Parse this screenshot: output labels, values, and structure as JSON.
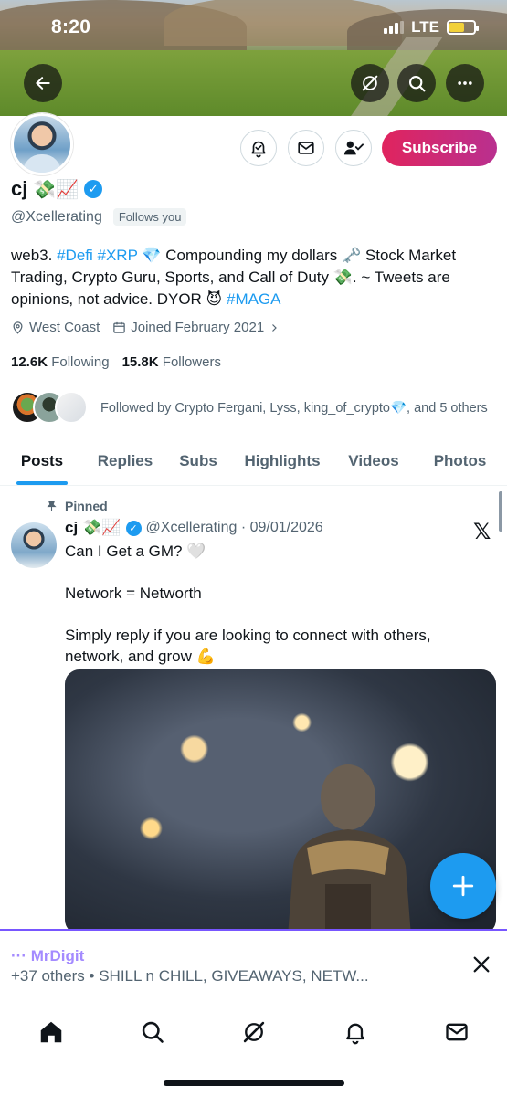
{
  "status_bar": {
    "time": "8:20",
    "network": "LTE"
  },
  "profile": {
    "name": "cj",
    "name_emojis": "💸📈",
    "handle": "@Xcellerating",
    "follows_you": "Follows you",
    "subscribe_label": "Subscribe",
    "bio_parts": [
      {
        "text": "web3. ",
        "tag": false
      },
      {
        "text": "#Defi",
        "tag": true
      },
      {
        "text": " ",
        "tag": false
      },
      {
        "text": "#XRP",
        "tag": true
      },
      {
        "text": " 💎 Compounding my dollars 🗝️ Stock Market Trading, Crypto Guru, Sports, and Call of Duty 💸. ~ Tweets are opinions, not advice. DYOR 😈 ",
        "tag": false
      },
      {
        "text": "#MAGA",
        "tag": true
      }
    ],
    "location": "West Coast",
    "joined": "Joined February 2021",
    "following_count": "12.6K",
    "following_label": "Following",
    "followers_count": "15.8K",
    "followers_label": "Followers",
    "followed_by": "Followed by Crypto Fergani, Lyss, king_of_crypto💎, and 5 others"
  },
  "tabs": [
    {
      "label": "Posts",
      "active": true
    },
    {
      "label": "Replies",
      "active": false
    },
    {
      "label": "Subs",
      "active": false
    },
    {
      "label": "Highlights",
      "active": false
    },
    {
      "label": "Videos",
      "active": false
    },
    {
      "label": "Photos",
      "active": false
    }
  ],
  "post": {
    "pinned_label": "Pinned",
    "author_name": "cj",
    "author_emojis": "💸📈",
    "handle_date": "@Xcellerating · 09/01/2026",
    "lines": [
      "Can I Get a GM? 🤍",
      "",
      "Network = Networth",
      "",
      "Simply reply if you are looking to connect with others, network, and grow 💪"
    ],
    "x_logo": "𝕏"
  },
  "space": {
    "host": "··· MrDigit",
    "subtitle": "+37 others • SHILL n CHILL, GIVEAWAYS, NETW..."
  },
  "icons": {
    "back": "back-arrow-icon",
    "grok": "grok-icon",
    "search": "search-icon",
    "more": "more-icon",
    "notify": "notification-bell-icon",
    "message": "mail-icon",
    "following": "person-check-icon",
    "location": "location-pin-icon",
    "calendar": "calendar-icon",
    "pin": "pin-icon",
    "compose": "plus-icon",
    "close": "close-icon",
    "nav_home": "home-icon",
    "nav_search": "search-icon",
    "nav_grok": "grok-icon",
    "nav_notifications": "bell-icon",
    "nav_messages": "mail-icon"
  },
  "colors": {
    "accent": "#1d9bf0",
    "subscribe_from": "#e0245e",
    "subscribe_to": "#b9308f",
    "space": "#7856ff"
  }
}
